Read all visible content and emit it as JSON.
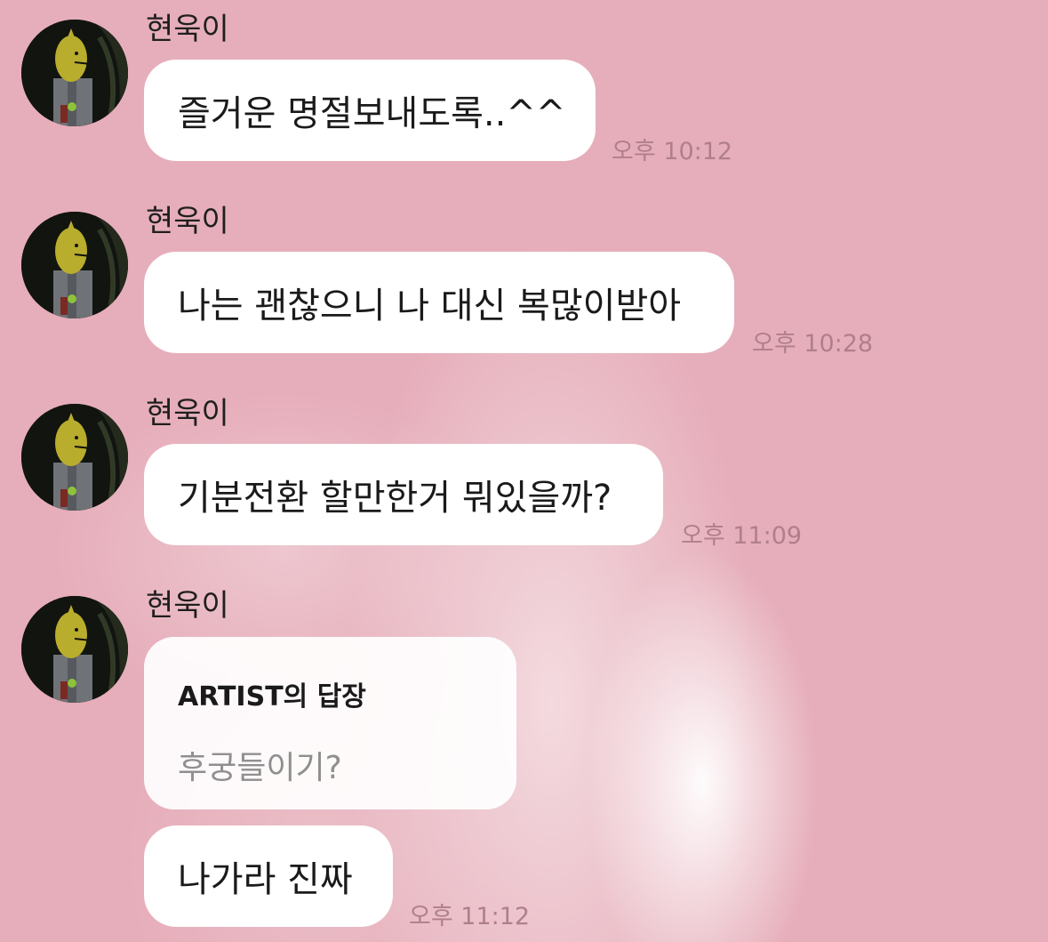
{
  "sender_name": "현욱이",
  "messages": [
    {
      "text": "즐거운 명절보내도록..^^",
      "time": "오후 10:12"
    },
    {
      "text": "나는 괜찮으니 나 대신 복많이받아",
      "time": "오후 10:28"
    },
    {
      "text": "기분전환 할만한거 뭐있을까?",
      "time": "오후 11:09"
    }
  ],
  "reply": {
    "header": "ARTIST의 답장",
    "quoted": "후궁들이기?",
    "text": "나가라 진짜",
    "time": "오후 11:12"
  },
  "colors": {
    "background": "#e6aeba",
    "bubble": "#ffffff",
    "timestamp": "#b07f8b"
  }
}
